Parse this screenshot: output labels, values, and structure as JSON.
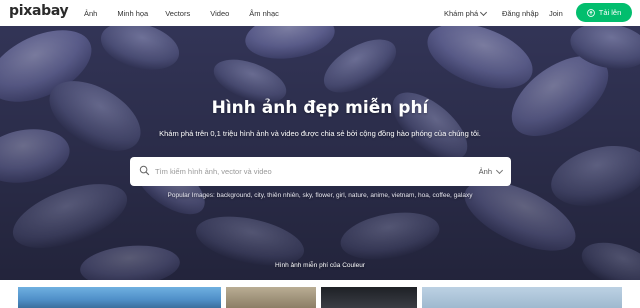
{
  "header": {
    "logo": "pixabay",
    "nav": [
      "Ảnh",
      "Minh họa",
      "Vectors",
      "Video",
      "Âm nhạc"
    ],
    "explore_label": "Khám phá",
    "login_label": "Đăng nhập",
    "join_label": "Join",
    "upload_label": "Tải lên",
    "accent_color": "#02be6e"
  },
  "hero": {
    "title": "Hình ảnh đẹp miễn phí",
    "subtitle": "Khám phá trên 0,1 triệu hình ảnh và video được chia sẻ bởi cộng đồng hào phóng của chúng tôi.",
    "search_placeholder": "Tìm kiếm hình ảnh, vector và video",
    "search_type": "Ảnh",
    "popular": "Popular Images: background, city, thiên nhiên, sky, flower, girl, nature, anime, vietnam, hoa, coffee, galaxy",
    "credit": "Hình ảnh miễn phí của Couleur"
  }
}
